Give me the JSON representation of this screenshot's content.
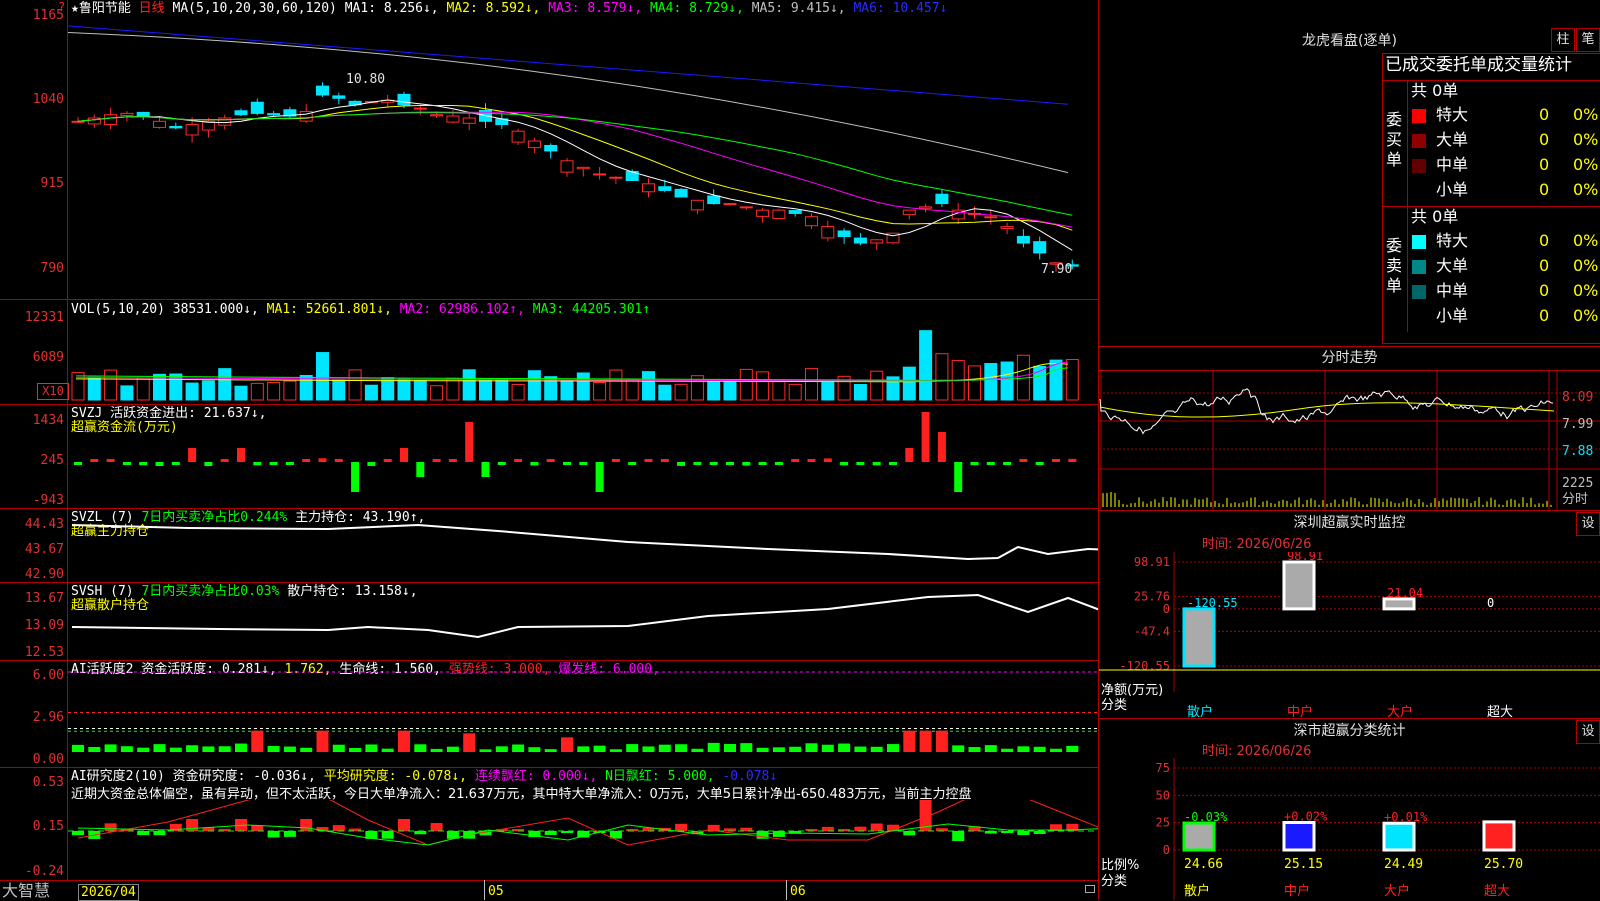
{
  "colors": {
    "up": "#ff2a2a",
    "down": "#00e5ff",
    "vol_down": "#00e5ff",
    "ma1": "#ffffff",
    "ma2": "#ffff00",
    "ma3": "#ff00ff",
    "ma4": "#00ff00",
    "ma5": "#c0c0c0",
    "ma6": "#1a1aff",
    "grid": "#b00000",
    "axis_text": "#e03030"
  },
  "kline": {
    "header": {
      "star": "★",
      "name": "鲁阳节能",
      "period": "日线",
      "ma_title": "MA(5,10,20,30,60,120)",
      "ma1": "MA1: 8.256↓,",
      "ma2": "MA2: 8.592↓,",
      "ma3": "MA3: 8.579↓,",
      "ma4": "MA4: 8.729↓,",
      "ma5": "MA5: 9.415↓,",
      "ma6": "MA6: 10.457↓"
    },
    "yticks": [
      "1165",
      "1040",
      "915",
      "790"
    ],
    "high_label": "10.80",
    "low_label": "7.90",
    "flag": "?"
  },
  "vol": {
    "title": "VOL(5,10,20)",
    "value": "38531.000↓,",
    "ma1": "MA1: 52661.801↓,",
    "ma2": "MA2: 62986.102↑,",
    "ma3": "MA3: 44205.301↑",
    "yticks": [
      "12331",
      "6089"
    ],
    "unit": "X10"
  },
  "svzj": {
    "line1_a": "SVZJ",
    "line1_b": "活跃资金进出: 21.637↓,",
    "line2": "超赢资金流(万元)",
    "yticks": [
      "1434",
      "245",
      "-943"
    ]
  },
  "svzl": {
    "line1_a": "SVZL (7)",
    "line1_b": "7日内买卖净占比0.244%",
    "line1_c": "主力持仓: 43.190↑,",
    "line2": "超赢主力持仓",
    "yticks": [
      "44.43",
      "43.67",
      "42.90"
    ]
  },
  "svsh": {
    "line1_a": "SVSH (7)",
    "line1_b": "7日内买卖净占比0.03%",
    "line1_c": "散户持仓: 13.158↓,",
    "line2": "超赢散户持仓",
    "yticks": [
      "13.67",
      "13.09",
      "12.53"
    ]
  },
  "ai_active": {
    "a": "AI活跃度2 资金活跃度: 0.281↓,",
    "b": "1.762,",
    "c": "生命线: 1.560,",
    "d": "强势线: 3.000,",
    "e": "爆发线: 6.000,",
    "yticks": [
      "6.00",
      "2.96",
      "0.00"
    ]
  },
  "ai_research": {
    "a": "AI研究度2(10) 资金研究度: -0.036↓,",
    "b": "平均研究度: -0.078↓,",
    "c": "连续飘红: 0.000↓,",
    "d": "N日飘红: 5.000,",
    "e": "-0.078↓",
    "desc": "近期大资金总体偏空，虽有异动，但不太活跃，今日大单净流入：21.637万元，其中特大单净流入：0万元，大单5日累计净出-650.483万元，当前主力控盘",
    "yticks": [
      "0.53",
      "0.15",
      "-0.24"
    ]
  },
  "bottom": {
    "brand": "大智慧",
    "date1": "2026/04",
    "date2": "05",
    "date3": "06"
  },
  "dragon": {
    "title": "龙虎看盘(逐单)",
    "btn_zhu": "柱",
    "btn_bi": "笔",
    "header": "已成交委托单成交量统计",
    "buy_label": "委买单",
    "sell_label": "委卖单",
    "buy_total": "共 0单",
    "sell_total": "共 0单",
    "buy_rows": [
      {
        "name": "特大",
        "count": "0",
        "pct": "0%",
        "color": "#ff0000"
      },
      {
        "name": "大单",
        "count": "0",
        "pct": "0%",
        "color": "#900000"
      },
      {
        "name": "中单",
        "count": "0",
        "pct": "0%",
        "color": "#600000"
      },
      {
        "name": "小单",
        "count": "0",
        "pct": "0%",
        "color": "#000000"
      }
    ],
    "sell_rows": [
      {
        "name": "特大",
        "count": "0",
        "pct": "0%",
        "color": "#00ffff"
      },
      {
        "name": "大单",
        "count": "0",
        "pct": "0%",
        "color": "#008888"
      },
      {
        "name": "中单",
        "count": "0",
        "pct": "0%",
        "color": "#006666"
      },
      {
        "name": "小单",
        "count": "0",
        "pct": "0%",
        "color": "#000000"
      }
    ]
  },
  "intraday": {
    "title": "分时走势",
    "yticks": [
      "8.09",
      "7.99",
      "7.88"
    ],
    "vol_ticks": [
      "2225",
      "分时"
    ]
  },
  "monitor": {
    "title": "深圳超赢实时监控",
    "btn": "设",
    "time": "时间: 2026/06/26",
    "yticks": [
      "98.91",
      "25.76",
      "0",
      "-47.4",
      "-120.55"
    ],
    "unit_a": "净额(万元)",
    "unit_b": "分类",
    "categories": [
      "散户",
      "中户",
      "大户",
      "超大"
    ],
    "values": [
      -120.55,
      98.91,
      21.04,
      0
    ],
    "value_labels": [
      "-120.55",
      "98.91",
      "21.04",
      "0"
    ]
  },
  "classify": {
    "title": "深市超赢分类统计",
    "btn": "设",
    "time": "时间: 2026/06/26",
    "yticks": [
      "75",
      "50",
      "25",
      "0"
    ],
    "unit_a": "比例%",
    "unit_b": "分类",
    "categories": [
      "散户",
      "中户",
      "大户",
      "超大"
    ],
    "values": [
      24.66,
      25.15,
      24.49,
      25.7
    ],
    "value_labels": [
      "24.66",
      "25.15",
      "24.49",
      "25.70"
    ],
    "changes": [
      "-0.03%",
      "+0.02%",
      "+0.01%",
      ""
    ]
  },
  "chart_data": [
    {
      "type": "candlestick",
      "title": "鲁阳节能 日线",
      "x": [
        "2026/04",
        "05",
        "06"
      ],
      "ylim": [
        7.5,
        11.8
      ],
      "y_tick_labels": [
        "1165",
        "1040",
        "915",
        "790"
      ],
      "high": 10.8,
      "low": 7.9,
      "series": [
        {
          "name": "MA1",
          "last": 8.256
        },
        {
          "name": "MA2",
          "last": 8.592
        },
        {
          "name": "MA3",
          "last": 8.579
        },
        {
          "name": "MA4",
          "last": 8.729
        },
        {
          "name": "MA5",
          "last": 9.415
        },
        {
          "name": "MA6",
          "last": 10.457
        }
      ]
    },
    {
      "type": "bar",
      "title": "VOL(5,10,20)",
      "values_last": 38531.0,
      "series": [
        {
          "name": "MA1",
          "last": 52661.801
        },
        {
          "name": "MA2",
          "last": 62986.102
        },
        {
          "name": "MA3",
          "last": 44205.301
        }
      ],
      "ylim": [
        0,
        12331
      ]
    },
    {
      "type": "bar",
      "title": "深圳超赢实时监控",
      "categories": [
        "散户",
        "中户",
        "大户",
        "超大"
      ],
      "values": [
        -120.55,
        98.91,
        21.04,
        0
      ],
      "ylim": [
        -120.55,
        98.91
      ]
    },
    {
      "type": "bar",
      "title": "深市超赢分类统计",
      "categories": [
        "散户",
        "中户",
        "大户",
        "超大"
      ],
      "values": [
        24.66,
        25.15,
        24.49,
        25.7
      ],
      "ylim": [
        0,
        75
      ]
    }
  ]
}
